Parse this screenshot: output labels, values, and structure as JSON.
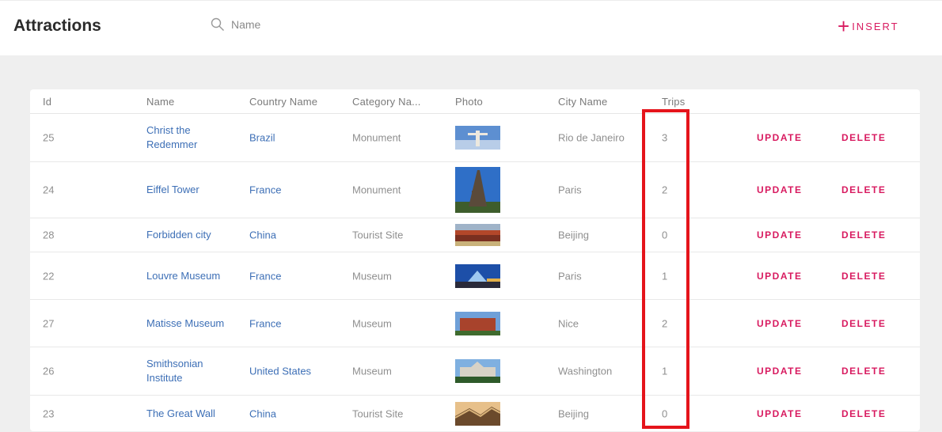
{
  "header": {
    "title": "Attractions",
    "search": {
      "placeholder": "Name",
      "value": ""
    },
    "insert_label": "INSERT"
  },
  "colors": {
    "accent": "#d81b60",
    "link": "#3d6fb6",
    "highlight": "#e5141b"
  },
  "table": {
    "columns": [
      "Id",
      "Name",
      "Country Name",
      "Category Na...",
      "Photo",
      "City Name",
      "Trips"
    ],
    "rows": [
      {
        "id": "25",
        "name": "Christ the Redemmer",
        "country": "Brazil",
        "category": "Monument",
        "photo": "christ-the-redeemer-photo",
        "city": "Rio de Janeiro",
        "trips": "3",
        "update": "UPDATE",
        "delete": "DELETE"
      },
      {
        "id": "24",
        "name": "Eiffel Tower",
        "country": "France",
        "category": "Monument",
        "photo": "eiffel-tower-photo",
        "city": "Paris",
        "trips": "2",
        "update": "UPDATE",
        "delete": "DELETE"
      },
      {
        "id": "28",
        "name": "Forbidden city",
        "country": "China",
        "category": "Tourist Site",
        "photo": "forbidden-city-photo",
        "city": "Beijing",
        "trips": "0",
        "update": "UPDATE",
        "delete": "DELETE"
      },
      {
        "id": "22",
        "name": "Louvre Museum",
        "country": "France",
        "category": "Museum",
        "photo": "louvre-museum-photo",
        "city": "Paris",
        "trips": "1",
        "update": "UPDATE",
        "delete": "DELETE"
      },
      {
        "id": "27",
        "name": "Matisse Museum",
        "country": "France",
        "category": "Museum",
        "photo": "matisse-museum-photo",
        "city": "Nice",
        "trips": "2",
        "update": "UPDATE",
        "delete": "DELETE"
      },
      {
        "id": "26",
        "name": "Smithsonian Institute",
        "country": "United States",
        "category": "Museum",
        "photo": "smithsonian-institute-photo",
        "city": "Washington",
        "trips": "1",
        "update": "UPDATE",
        "delete": "DELETE"
      },
      {
        "id": "23",
        "name": "The Great Wall",
        "country": "China",
        "category": "Tourist Site",
        "photo": "great-wall-photo",
        "city": "Beijing",
        "trips": "0",
        "update": "UPDATE",
        "delete": "DELETE"
      }
    ]
  }
}
